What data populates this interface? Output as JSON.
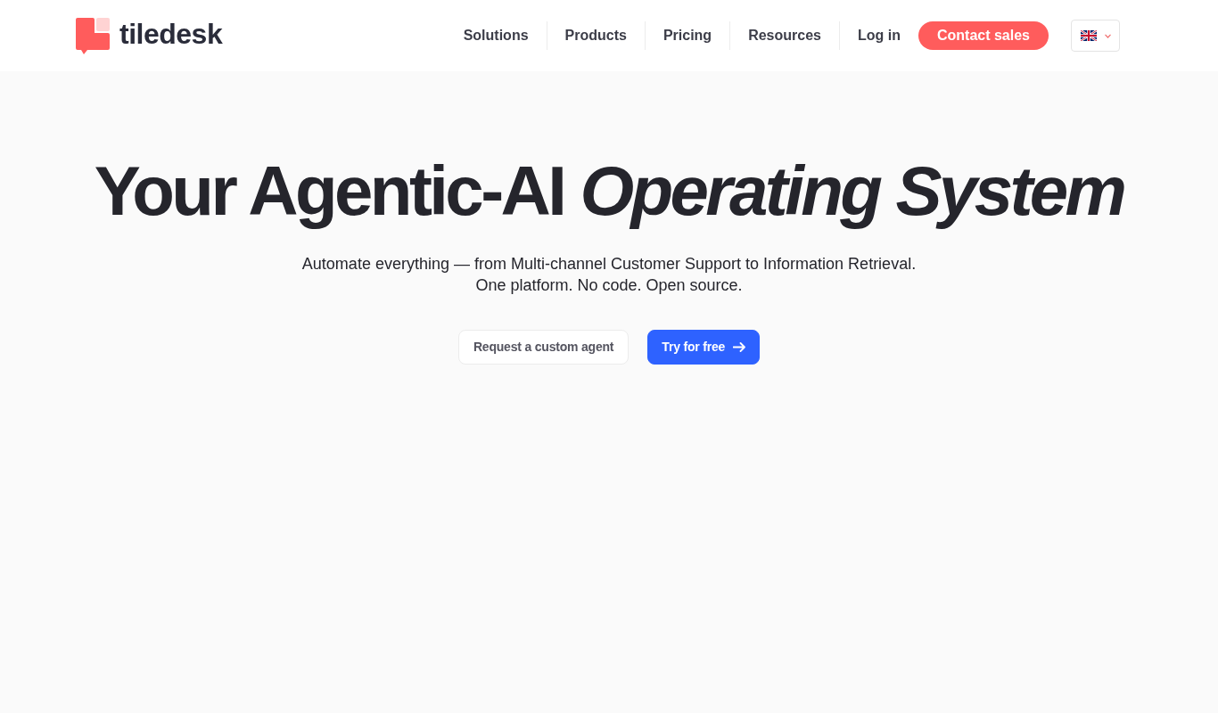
{
  "header": {
    "logo": {
      "text": "tiledesk"
    },
    "nav": [
      {
        "label": "Solutions"
      },
      {
        "label": "Products"
      },
      {
        "label": "Pricing"
      },
      {
        "label": "Resources"
      },
      {
        "label": "Log in"
      }
    ],
    "cta": "Contact sales"
  },
  "hero": {
    "title": "Your Agentic-AI *Operating System*",
    "subtitle": [
      "Automate everything — from Multi-channel Customer Support to Information Retrieval.",
      "One platform. No code. Open source."
    ],
    "buttons": [
      {
        "label": "Request a custom agent",
        "kind": "secondary"
      },
      {
        "label": "Try for free",
        "kind": "primary"
      }
    ]
  }
}
